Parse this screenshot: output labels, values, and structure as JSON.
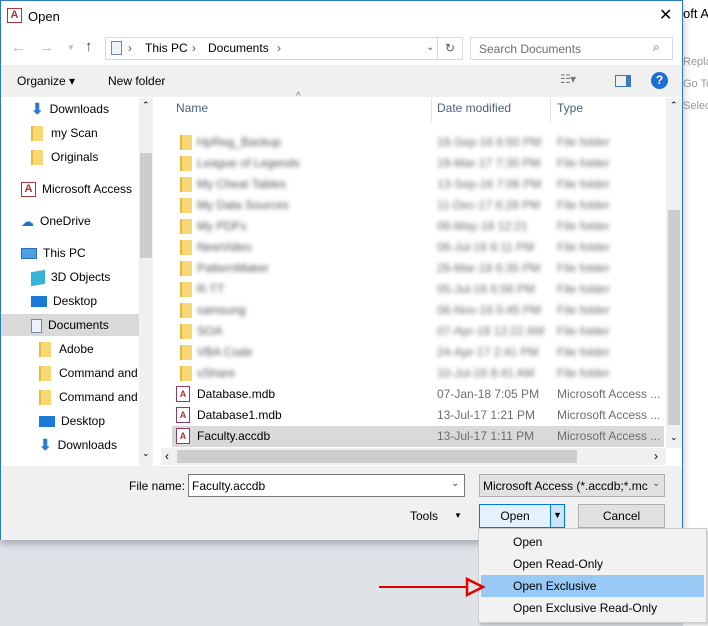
{
  "background_app": {
    "title_fragment": "oft A",
    "items": [
      "Repla",
      "Go To",
      "Selec"
    ]
  },
  "dialog": {
    "title": "Open",
    "app_icon_letter": "A",
    "close_label": "✕"
  },
  "address": {
    "path": [
      "This PC",
      "Documents"
    ],
    "search_placeholder": "Search Documents"
  },
  "toolbar": {
    "organize": "Organize ▾",
    "new_folder": "New folder",
    "help": "?"
  },
  "nav": {
    "items": [
      {
        "label": "Downloads",
        "icon": "download-arrow-icon"
      },
      {
        "label": "my Scan",
        "icon": "folder-icon"
      },
      {
        "label": "Originals",
        "icon": "folder-icon"
      },
      {
        "label": "Microsoft Access",
        "icon": "access-icon"
      },
      {
        "label": "OneDrive",
        "icon": "cloud-icon"
      },
      {
        "label": "This PC",
        "icon": "computer-icon"
      },
      {
        "label": "3D Objects",
        "icon": "cube-icon"
      },
      {
        "label": "Desktop",
        "icon": "desktop-icon"
      },
      {
        "label": "Documents",
        "icon": "document-icon",
        "selected": true
      },
      {
        "label": "Adobe",
        "icon": "folder-icon"
      },
      {
        "label": "Command and",
        "icon": "folder-icon"
      },
      {
        "label": "Command and",
        "icon": "folder-icon"
      },
      {
        "label": "Desktop",
        "icon": "desktop-icon"
      },
      {
        "label": "Downloads",
        "icon": "download-arrow-icon"
      }
    ]
  },
  "columns": {
    "name": "Name",
    "date": "Date modified",
    "type": "Type"
  },
  "folders": [
    {
      "name": "HpReg_Backup",
      "date": "18-Sep-16 6:50 PM",
      "type": "File folder"
    },
    {
      "name": "League of Legends",
      "date": "19-Mar-17 7:30 PM",
      "type": "File folder"
    },
    {
      "name": "My Cheat Tables",
      "date": "13-Sep-16 7:06 PM",
      "type": "File folder"
    },
    {
      "name": "My Data Sources",
      "date": "11-Dec-17 6:28 PM",
      "type": "File folder"
    },
    {
      "name": "My PDFs",
      "date": "06-May-18 12:21",
      "type": "File folder"
    },
    {
      "name": "NewVideo",
      "date": "06-Jul-16 6:11 PM",
      "type": "File folder"
    },
    {
      "name": "PatternMaker",
      "date": "26-Mar-18 6:35 PM",
      "type": "File folder"
    },
    {
      "name": "R-TT",
      "date": "05-Jul-16 6:56 PM",
      "type": "File folder"
    },
    {
      "name": "samsung",
      "date": "06-Nov-16 5:45 PM",
      "type": "File folder"
    },
    {
      "name": "SOA",
      "date": "07-Apr-18 12:22 AM",
      "type": "File folder"
    },
    {
      "name": "VBA Code",
      "date": "24-Apr-17 2:41 PM",
      "type": "File folder"
    },
    {
      "name": "vShare",
      "date": "10-Jul-16 8:41 AM",
      "type": "File folder"
    }
  ],
  "files": [
    {
      "name": "Database.mdb",
      "date": "07-Jan-18 7:05 PM",
      "type": "Microsoft Access ..."
    },
    {
      "name": "Database1.mdb",
      "date": "13-Jul-17 1:21 PM",
      "type": "Microsoft Access ..."
    },
    {
      "name": "Faculty.accdb",
      "date": "13-Jul-17 1:11 PM",
      "type": "Microsoft Access ...",
      "selected": true
    }
  ],
  "bottom": {
    "file_name_label": "File name:",
    "file_name_value": "Faculty.accdb",
    "filter": "Microsoft Access (*.accdb;*.mc",
    "tools": "Tools",
    "open": "Open",
    "cancel": "Cancel"
  },
  "open_menu": {
    "items": [
      "Open",
      "Open Read-Only",
      "Open Exclusive",
      "Open Exclusive Read-Only"
    ],
    "highlighted": "Open Exclusive"
  },
  "colors": {
    "highlight": "#99c9f5",
    "annotation_arrow": "#e00000",
    "selection": "#d9d9d9"
  }
}
